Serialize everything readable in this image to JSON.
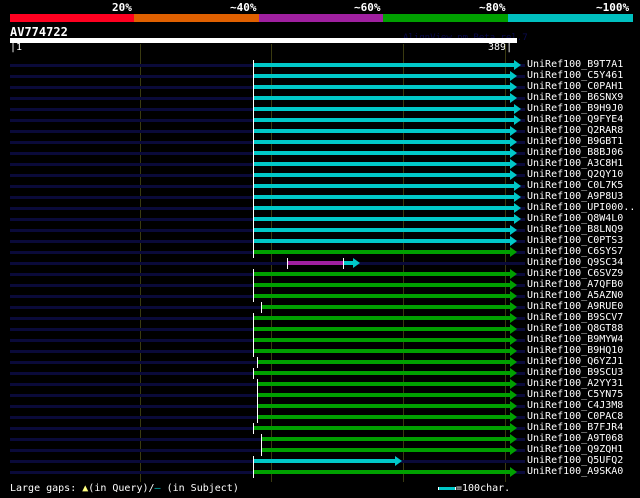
{
  "score_legend": {
    "labels": [
      "20%",
      "~40%",
      "~60%",
      "~80%",
      "~100%"
    ],
    "colors": [
      "#ff0020",
      "#e06000",
      "#a020a0",
      "#00a000",
      "#00c0c0"
    ]
  },
  "query": {
    "name": "AV774722",
    "version": "AlignView.pm Beta rel.7",
    "start": "1",
    "end": "389",
    "length": 389
  },
  "colors": {
    "cyan": "#00c8c8",
    "green": "#00a000",
    "purple": "#a020a0",
    "navy": "#0a0a3a"
  },
  "hits": [
    {
      "name": "UniRef100_B9T7A1",
      "start": 187,
      "end": 388,
      "color": "cyan"
    },
    {
      "name": "UniRef100_C5Y461",
      "start": 187,
      "end": 385,
      "color": "cyan"
    },
    {
      "name": "UniRef100_C0PAH1",
      "start": 187,
      "end": 385,
      "color": "cyan"
    },
    {
      "name": "UniRef100_B6SNX9",
      "start": 187,
      "end": 385,
      "color": "cyan"
    },
    {
      "name": "UniRef100_B9H9J0",
      "start": 187,
      "end": 388,
      "color": "cyan"
    },
    {
      "name": "UniRef100_Q9FYE4",
      "start": 187,
      "end": 388,
      "color": "cyan"
    },
    {
      "name": "UniRef100_Q2RAR8",
      "start": 187,
      "end": 385,
      "color": "cyan"
    },
    {
      "name": "UniRef100_B9GBT1",
      "start": 187,
      "end": 385,
      "color": "cyan"
    },
    {
      "name": "UniRef100_B8BJ06",
      "start": 187,
      "end": 385,
      "color": "cyan"
    },
    {
      "name": "UniRef100_A3C8H1",
      "start": 187,
      "end": 385,
      "color": "cyan"
    },
    {
      "name": "UniRef100_Q2QY10",
      "start": 187,
      "end": 385,
      "color": "cyan"
    },
    {
      "name": "UniRef100_C0L7K5",
      "start": 187,
      "end": 388,
      "color": "cyan"
    },
    {
      "name": "UniRef100_A9P8U3",
      "start": 187,
      "end": 388,
      "color": "cyan"
    },
    {
      "name": "UniRef100_UPI000..",
      "start": 187,
      "end": 388,
      "color": "cyan"
    },
    {
      "name": "UniRef100_Q8W4L0",
      "start": 187,
      "end": 388,
      "color": "cyan"
    },
    {
      "name": "UniRef100_B8LNQ9",
      "start": 187,
      "end": 385,
      "color": "cyan"
    },
    {
      "name": "UniRef100_C0PTS3",
      "start": 187,
      "end": 385,
      "color": "cyan"
    },
    {
      "name": "UniRef100_C6SYS7",
      "start": 187,
      "end": 385,
      "color": "green"
    },
    {
      "name": "UniRef100_Q9SC34",
      "start": 213,
      "end": 265,
      "color": "purple",
      "split": 256
    },
    {
      "name": "UniRef100_C6SVZ9",
      "start": 187,
      "end": 385,
      "color": "green"
    },
    {
      "name": "UniRef100_A7QFB0",
      "start": 187,
      "end": 385,
      "color": "green"
    },
    {
      "name": "UniRef100_A5AZN0",
      "start": 187,
      "end": 385,
      "color": "green"
    },
    {
      "name": "UniRef100_A9RUE0",
      "start": 193,
      "end": 385,
      "color": "green"
    },
    {
      "name": "UniRef100_B9SCV7",
      "start": 187,
      "end": 385,
      "color": "green"
    },
    {
      "name": "UniRef100_Q8GT88",
      "start": 187,
      "end": 385,
      "color": "green"
    },
    {
      "name": "UniRef100_B9MYW4",
      "start": 187,
      "end": 385,
      "color": "green"
    },
    {
      "name": "UniRef100_B9HQ10",
      "start": 187,
      "end": 385,
      "color": "green"
    },
    {
      "name": "UniRef100_Q6YZJ1",
      "start": 190,
      "end": 385,
      "color": "green"
    },
    {
      "name": "UniRef100_B9SCU3",
      "start": 187,
      "end": 385,
      "color": "green"
    },
    {
      "name": "UniRef100_A2YY31",
      "start": 190,
      "end": 385,
      "color": "green"
    },
    {
      "name": "UniRef100_C5YN75",
      "start": 190,
      "end": 385,
      "color": "green"
    },
    {
      "name": "UniRef100_C4J3M8",
      "start": 190,
      "end": 385,
      "color": "green"
    },
    {
      "name": "UniRef100_C0PAC8",
      "start": 190,
      "end": 385,
      "color": "green"
    },
    {
      "name": "UniRef100_B7FJR4",
      "start": 187,
      "end": 385,
      "color": "green"
    },
    {
      "name": "UniRef100_A9T068",
      "start": 193,
      "end": 385,
      "color": "green"
    },
    {
      "name": "UniRef100_Q9ZQH1",
      "start": 193,
      "end": 385,
      "color": "green"
    },
    {
      "name": "UniRef100_Q5UFQ2",
      "start": 187,
      "end": 297,
      "color": "cyan"
    },
    {
      "name": "UniRef100_A9SKA0",
      "start": 187,
      "end": 385,
      "color": "green"
    }
  ],
  "footer": {
    "gaps_label": "Large gaps:",
    "query_gap": "(in Query)/",
    "subject_gap": "(in Subject)",
    "scale_label": "=100char."
  }
}
